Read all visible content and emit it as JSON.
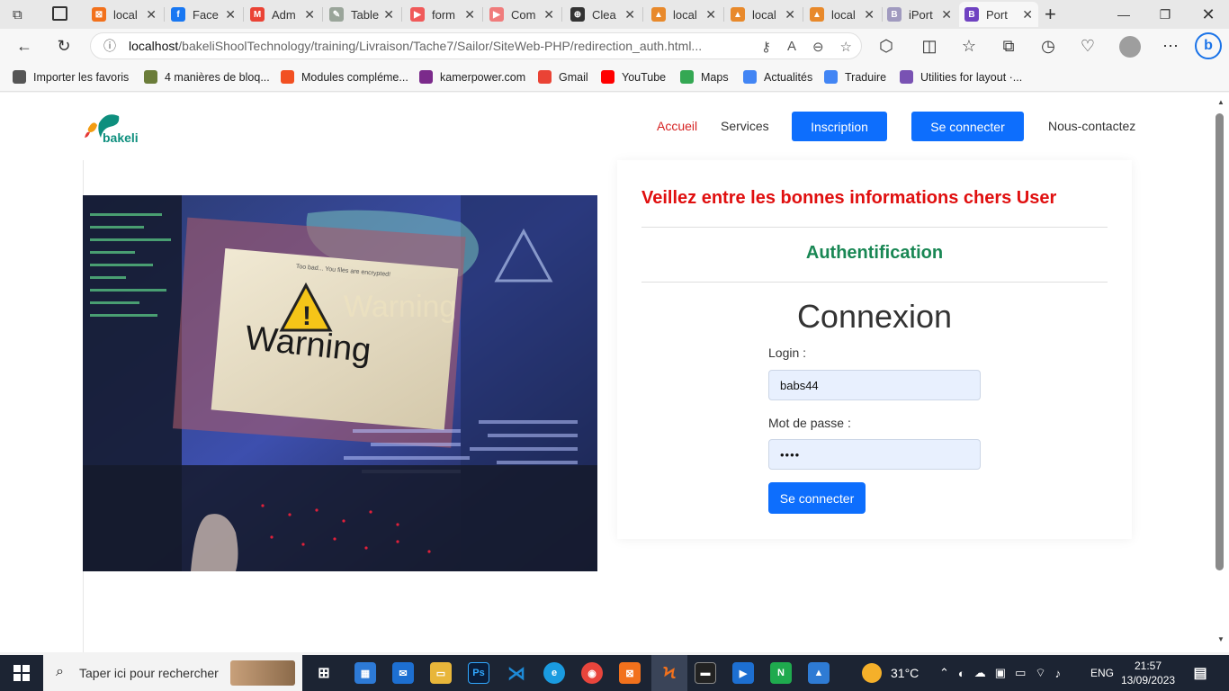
{
  "browser": {
    "tabs": [
      {
        "title": "local",
        "icon": "xampp-icon",
        "color": "#f2711c",
        "glyph": "⊠"
      },
      {
        "title": "Face",
        "icon": "facebook-icon",
        "color": "#1877f2",
        "glyph": "f"
      },
      {
        "title": "Adm",
        "icon": "gmail-icon",
        "color": "#ea4335",
        "glyph": "M"
      },
      {
        "title": "Table",
        "icon": "table-icon",
        "color": "#9aa59a",
        "glyph": "✎"
      },
      {
        "title": "form",
        "icon": "youtube-icon",
        "color": "#f05a5a",
        "glyph": "▶"
      },
      {
        "title": "Com",
        "icon": "youtube-icon",
        "color": "#f07c7c",
        "glyph": "▶"
      },
      {
        "title": "Clea",
        "icon": "globe-icon",
        "color": "#333333",
        "glyph": "⊕"
      },
      {
        "title": "local",
        "icon": "phpmyadmin-icon",
        "color": "#e8892b",
        "glyph": "▲"
      },
      {
        "title": "local",
        "icon": "phpmyadmin-icon",
        "color": "#e8892b",
        "glyph": "▲"
      },
      {
        "title": "local",
        "icon": "phpmyadmin-icon",
        "color": "#e8892b",
        "glyph": "▲"
      },
      {
        "title": "iPort",
        "icon": "bootstrap-icon",
        "color": "#a09abf",
        "glyph": "B"
      },
      {
        "title": "Port",
        "icon": "bootstrap-icon",
        "color": "#6f42c1",
        "glyph": "B",
        "active": true
      }
    ],
    "url_host": "localhost",
    "url_path": "/bakeliShoolTechnology/training/Livraison/Tache7/Sailor/SiteWeb-PHP/redirection_auth.html...",
    "bookmarks": [
      {
        "label": "Importer les favoris",
        "icon": "import-icon",
        "color": "#555555"
      },
      {
        "label": "4 manières de bloq...",
        "icon": "wikihow-icon",
        "color": "#6b7d3a"
      },
      {
        "label": "Modules compléme...",
        "icon": "microsoft-icon",
        "color": "#f25022"
      },
      {
        "label": "kamerpower.com",
        "icon": "kamerpower-icon",
        "color": "#7b2a8b"
      },
      {
        "label": "Gmail",
        "icon": "gmail-icon",
        "color": "#ea4335"
      },
      {
        "label": "YouTube",
        "icon": "youtube-icon",
        "color": "#ff0000"
      },
      {
        "label": "Maps",
        "icon": "maps-icon",
        "color": "#34a853"
      },
      {
        "label": "Actualités",
        "icon": "news-icon",
        "color": "#4285f4"
      },
      {
        "label": "Traduire",
        "icon": "translate-icon",
        "color": "#4285f4"
      },
      {
        "label": "Utilities for layout ·...",
        "icon": "bootstrap-icon",
        "color": "#7952b3"
      }
    ]
  },
  "site": {
    "logo_text": "bakeli",
    "nav": {
      "accueil": "Accueil",
      "services": "Services",
      "inscription": "Inscription",
      "connecter": "Se connecter",
      "contact": "Nous-contactez"
    },
    "hero_words": {
      "warning_main": "Warning",
      "warning_ghost": "Warning",
      "popup_title": "Too bad... You files are encrypted!"
    },
    "card": {
      "title": "Veillez entre les bonnes informations chers User",
      "subtitle": "Authentification",
      "heading": "Connexion",
      "login_label": "Login :",
      "login_value": "babs44",
      "password_label": "Mot de passe :",
      "password_value": "••••",
      "submit": "Se connecter"
    }
  },
  "taskbar": {
    "search_placeholder": "Taper ici pour rechercher",
    "weather": "31°C",
    "lang": "ENG",
    "time": "21:57",
    "date": "13/09/2023"
  },
  "colors": {
    "primary": "#0d6efd",
    "active_nav": "#d62323",
    "title_red": "#e00f0f",
    "green": "#198754",
    "input_bg": "#e8f0fe"
  }
}
